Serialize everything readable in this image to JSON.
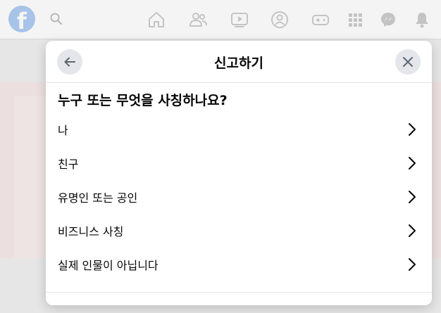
{
  "topbar": {
    "logo_letter": "f"
  },
  "dialog": {
    "title": "신고하기",
    "question": "누구 또는 무엇을 사칭하나요?",
    "options": [
      {
        "label": "나"
      },
      {
        "label": "친구"
      },
      {
        "label": "유명인 또는 공인"
      },
      {
        "label": "비즈니스 사칭"
      },
      {
        "label": "실제 인물이 아닙니다"
      }
    ]
  },
  "colors": {
    "facebook_blue": "#1877f2",
    "button_grey": "#e4e6eb",
    "text_primary": "#050505"
  }
}
